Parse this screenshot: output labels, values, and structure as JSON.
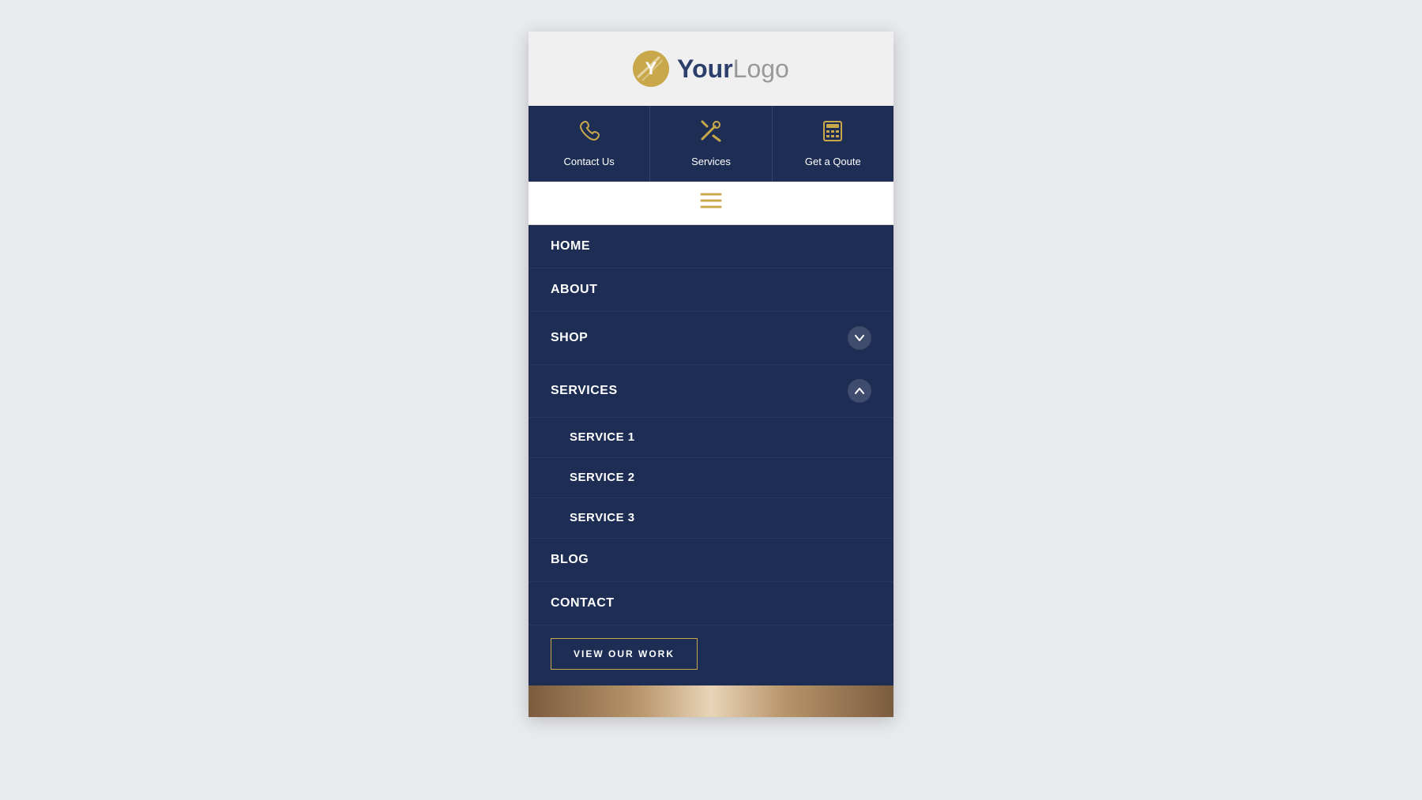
{
  "header": {
    "logo_bold": "Your",
    "logo_light": "Logo"
  },
  "top_nav": {
    "items": [
      {
        "id": "contact-us",
        "label": "Contact Us",
        "icon": "phone"
      },
      {
        "id": "services",
        "label": "Services",
        "icon": "tools"
      },
      {
        "id": "get-a-quote",
        "label": "Get a Qoute",
        "icon": "calculator"
      }
    ]
  },
  "hamburger": {
    "icon": "≡"
  },
  "nav_menu": {
    "items": [
      {
        "id": "home",
        "label": "HOME",
        "has_toggle": false,
        "toggle_open": false
      },
      {
        "id": "about",
        "label": "ABOUT",
        "has_toggle": false,
        "toggle_open": false
      },
      {
        "id": "shop",
        "label": "SHOP",
        "has_toggle": true,
        "toggle_open": false
      },
      {
        "id": "services",
        "label": "SERVICES",
        "has_toggle": true,
        "toggle_open": true,
        "sub_items": [
          {
            "id": "service-1",
            "label": "SERVICE 1"
          },
          {
            "id": "service-2",
            "label": "SERVICE 2"
          },
          {
            "id": "service-3",
            "label": "SERVICE 3"
          }
        ]
      },
      {
        "id": "blog",
        "label": "BLOG",
        "has_toggle": false,
        "toggle_open": false
      },
      {
        "id": "contact",
        "label": "CONTACT",
        "has_toggle": false,
        "toggle_open": false
      }
    ]
  },
  "cta": {
    "label": "VIEW OUR WORK"
  },
  "colors": {
    "navy": "#1e2d54",
    "gold": "#c9a84c",
    "white": "#ffffff",
    "bg": "#f0f0f0"
  }
}
